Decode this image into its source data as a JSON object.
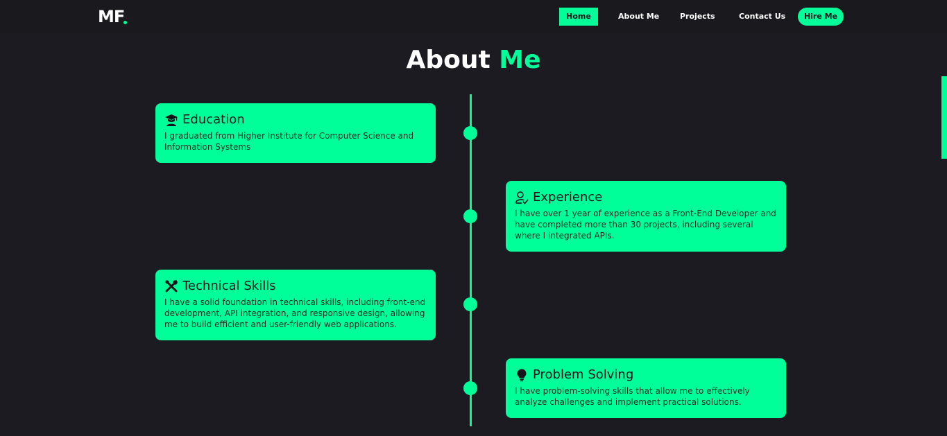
{
  "colors": {
    "accent": "#00ff99",
    "background": "#1c1b21",
    "navbar": "#1a191e",
    "card_text": "#14141a"
  },
  "navbar": {
    "logo": "MF",
    "links": [
      {
        "label": "Home",
        "active": true
      },
      {
        "label": "About Me",
        "active": false
      },
      {
        "label": "Projects",
        "active": false
      },
      {
        "label": "Contact Us",
        "active": false
      }
    ],
    "cta_label": "Hire Me"
  },
  "section": {
    "title_part1": "About",
    "title_part2": "Me"
  },
  "timeline": [
    {
      "icon": "graduate-icon",
      "title": "Education",
      "text": "I graduated from Higher Institute for Computer Science and Information Systems"
    },
    {
      "icon": "user-check-icon",
      "title": "Experience",
      "text": "I have over 1 year of experience as a Front-End Developer and have completed more than 30 projects, including several where I integrated APIs."
    },
    {
      "icon": "tools-icon",
      "title": "Technical Skills",
      "text": "I have a solid foundation in technical skills, including front-end development, API integration, and responsive design, allowing me to build efficient and user-friendly web applications."
    },
    {
      "icon": "lightbulb-icon",
      "title": "Problem Solving",
      "text": "I have problem-solving skills that allow me to effectively analyze challenges and implement practical solutions."
    }
  ]
}
